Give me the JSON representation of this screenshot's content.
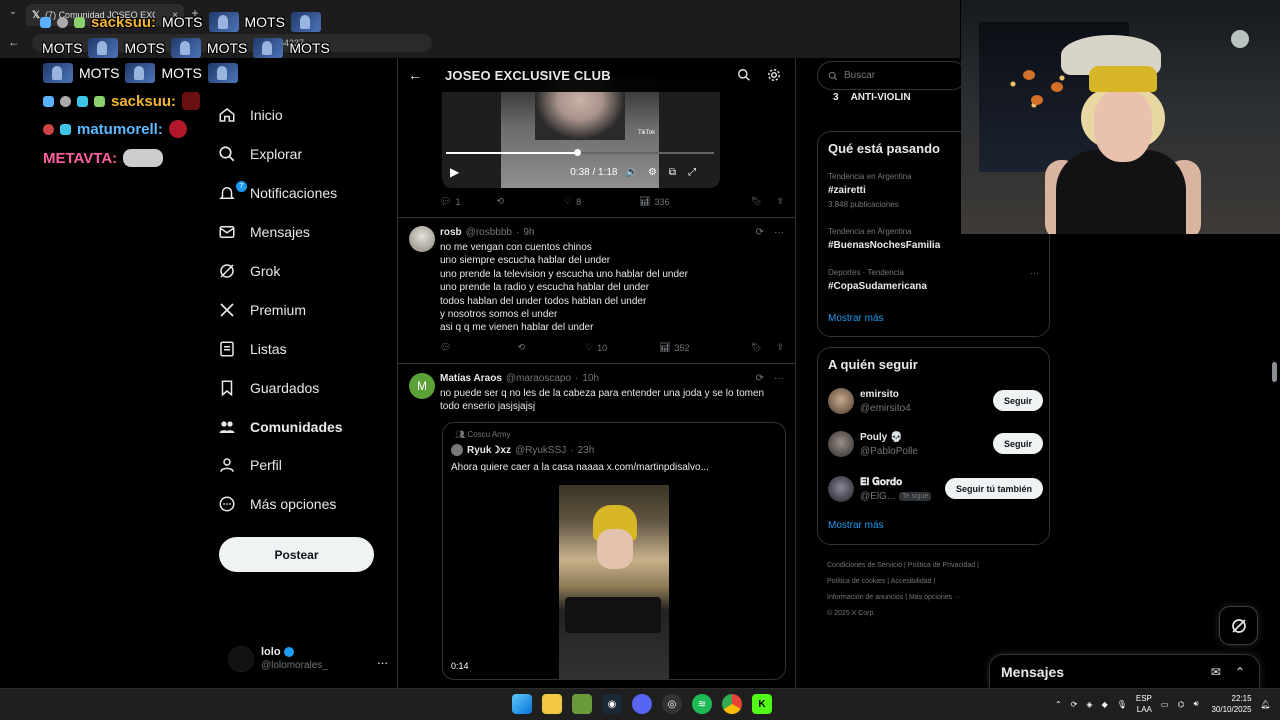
{
  "browser": {
    "tab_title": "(7) Comunidad JOSEO EXCLUSI",
    "tab_close": "×",
    "new_tab": "+",
    "url_fragment": "0395464337"
  },
  "chat_overlay": {
    "emote_word": "MOTS",
    "users": [
      "sacksuu:",
      "sacksuu:",
      "matumorell:",
      "METAVTA:"
    ]
  },
  "sidebar": {
    "items": [
      {
        "label": "Inicio",
        "icon": "home-icon"
      },
      {
        "label": "Explorar",
        "icon": "search-icon"
      },
      {
        "label": "Notificaciones",
        "icon": "bell-icon",
        "badge": "7"
      },
      {
        "label": "Mensajes",
        "icon": "mail-icon"
      },
      {
        "label": "Grok",
        "icon": "grok-icon"
      },
      {
        "label": "Premium",
        "icon": "x-logo-icon"
      },
      {
        "label": "Listas",
        "icon": "list-icon"
      },
      {
        "label": "Guardados",
        "icon": "bookmark-icon"
      },
      {
        "label": "Comunidades",
        "icon": "communities-icon"
      },
      {
        "label": "Perfil",
        "icon": "person-icon"
      },
      {
        "label": "Más opciones",
        "icon": "more-circle-icon"
      }
    ],
    "post_label": "Postear",
    "account": {
      "name": "lolo",
      "handle": "@lolomorales_",
      "more": "..."
    }
  },
  "timeline": {
    "title": "JOSEO EXCLUSIVE CLUB",
    "video": {
      "time": "0:38 / 1:18",
      "progress": 0.49,
      "watermark": "TikTok"
    },
    "tweet0_actions": {
      "replies": "1",
      "likes": "8",
      "views": "336"
    },
    "tweets": [
      {
        "name": "rosb",
        "handle": "@rosbbbb",
        "time": "9h",
        "lines": [
          "no me vengan con cuentos chinos",
          "uno siempre escucha hablar del under",
          "uno prende la television y escucha uno hablar del under",
          "uno prende la radio y escucha hablar del under",
          "todos hablan del under todos hablan del under",
          "y nosotros somos el under",
          "asi q q me vienen hablar del under"
        ],
        "replies": "",
        "likes": "10",
        "views": "352"
      },
      {
        "name": "Matías Araos",
        "handle": "@maraoscapo",
        "time": "10h",
        "avatar_letter": "M",
        "lines": [
          "no puede ser q no les de la cabeza para entender una joda y se lo tomen",
          "todo enserio jasjsjajsj"
        ],
        "quote": {
          "community": "Coscu Army",
          "name": "Ryuk☽xz",
          "handle": "@RyukSSJ",
          "time": "23h",
          "text": "Ahora quiere caer a la casa naaaa  x.com/martinpdisalvo...",
          "duration": "0:14"
        }
      }
    ]
  },
  "right": {
    "search_placeholder": "Buscar",
    "anti_rank": "3",
    "anti_label": "ANTI-VIOLIN",
    "trends_title": "Qué está pasando",
    "trends": [
      {
        "category": "Tendencia en Argentina",
        "tag": "#zairetti",
        "count": "3.848 publicaciones"
      },
      {
        "category": "Tendencia en Argentina",
        "tag": "#BuenasNochesFamilia",
        "count": ""
      },
      {
        "category": "Deportes · Tendencia",
        "tag": "#CopaSudamericana",
        "count": ""
      }
    ],
    "trends_more": "Mostrar más",
    "follow_title": "A quién seguir",
    "who_to_follow": [
      {
        "name": "emirsito",
        "handle": "@emirsito4",
        "button": "Seguir",
        "follows_you": ""
      },
      {
        "name": "Pouly 💀",
        "handle": "@PabloPolle",
        "button": "Seguir",
        "follows_you": ""
      },
      {
        "name": "𝐄𝐥 𝐆𝐨𝐫𝐝𝐨",
        "handle": "@ElG...",
        "button": "Seguir tú también",
        "follows_you": "Te sigue"
      }
    ],
    "follow_more": "Mostrar más",
    "footer": {
      "line1": "Condiciones de Servicio  |  Política de Privacidad  |",
      "line2": "Política de cookies  |  Accesibilidad  |",
      "line3": "Información de anuncios  |  Más opciones ···",
      "line4": "© 2025 X Corp."
    }
  },
  "messages_bar": {
    "title": "Mensajes"
  },
  "taskbar": {
    "lang1": "ESP",
    "lang2": "LAA",
    "time": "22:15",
    "date": "30/10/2025"
  },
  "colors": {
    "accent": "#1d9bf0",
    "bg": "#000000",
    "border": "#2f3336",
    "muted": "#71767b"
  }
}
